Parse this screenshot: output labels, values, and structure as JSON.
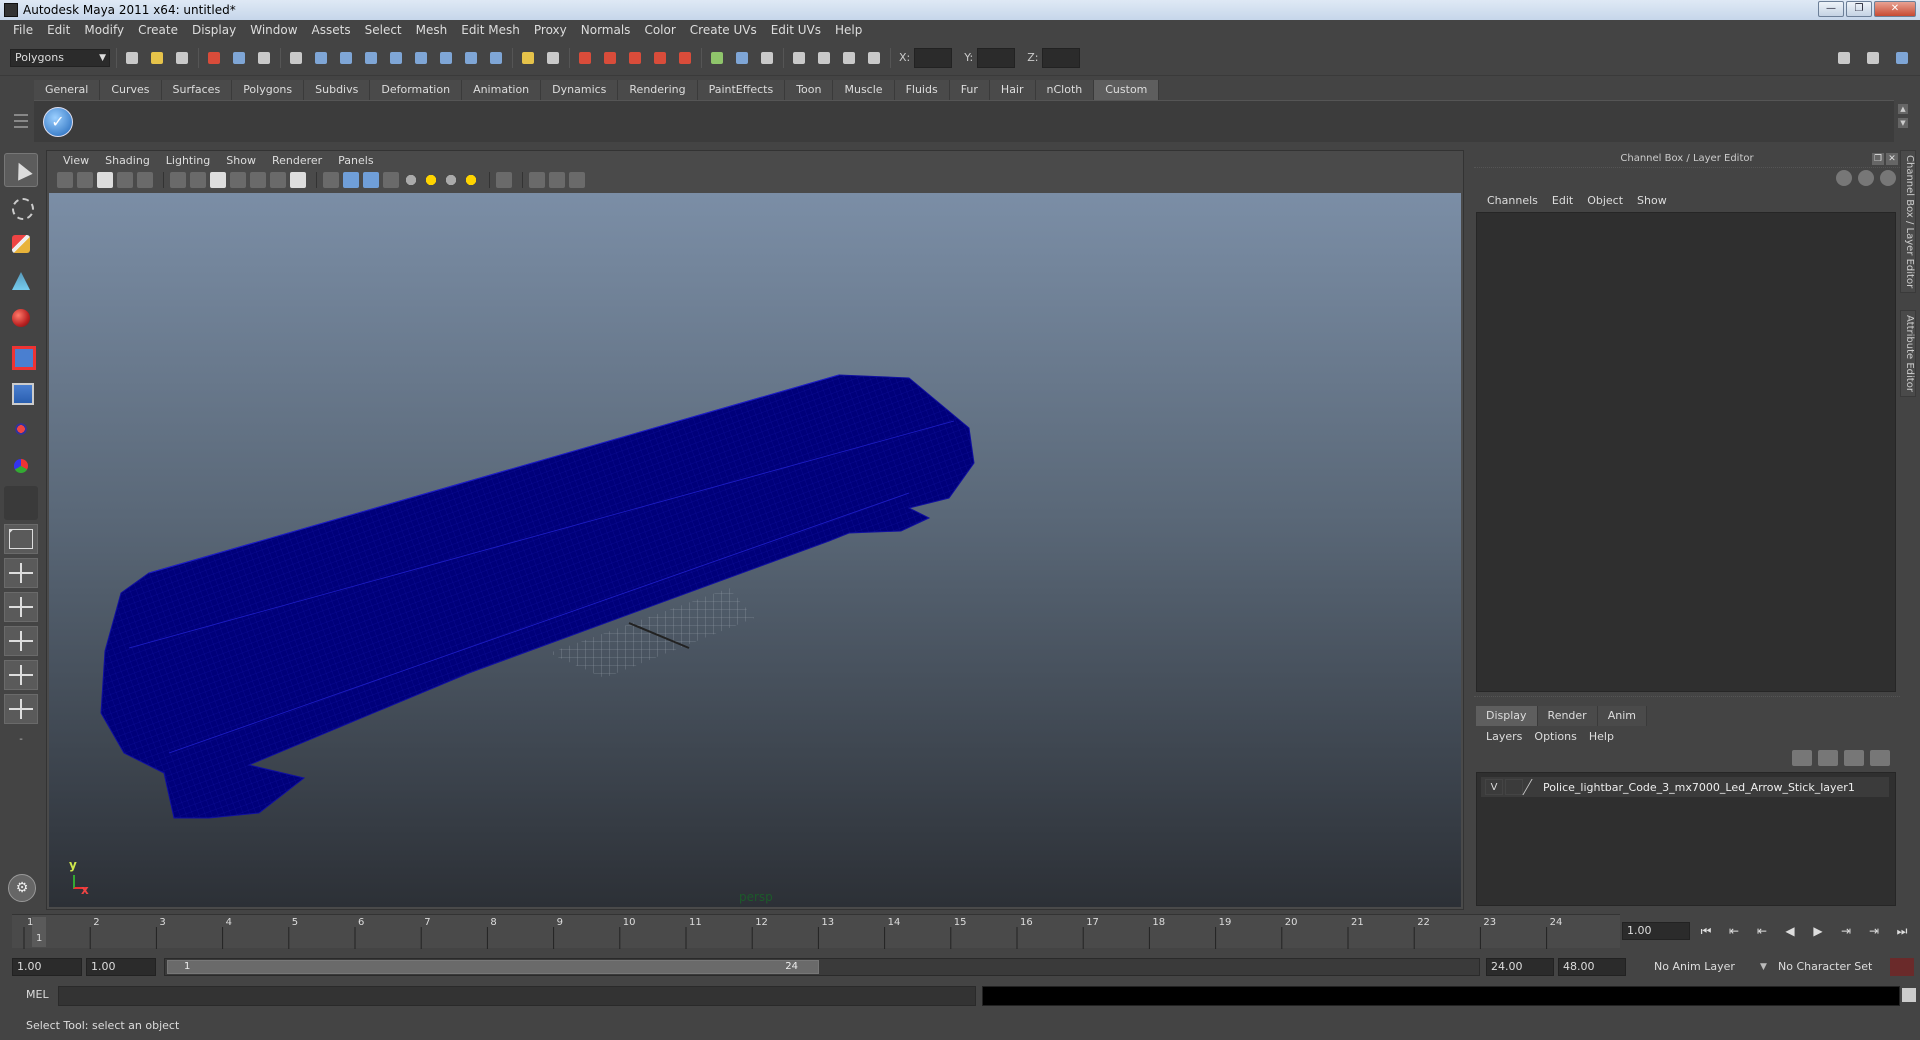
{
  "window": {
    "title": "Autodesk Maya 2011 x64: untitled*"
  },
  "menu": [
    "File",
    "Edit",
    "Modify",
    "Create",
    "Display",
    "Window",
    "Assets",
    "Select",
    "Mesh",
    "Edit Mesh",
    "Proxy",
    "Normals",
    "Color",
    "Create UVs",
    "Edit UVs",
    "Help"
  ],
  "statusline": {
    "mode": "Polygons",
    "x_label": "X:",
    "y_label": "Y:",
    "z_label": "Z:"
  },
  "shelf": {
    "tabs": [
      "General",
      "Curves",
      "Surfaces",
      "Polygons",
      "Subdivs",
      "Deformation",
      "Animation",
      "Dynamics",
      "Rendering",
      "PaintEffects",
      "Toon",
      "Muscle",
      "Fluids",
      "Fur",
      "Hair",
      "nCloth",
      "Custom"
    ],
    "active_tab": "Custom"
  },
  "icons": {
    "shelf_check": "checkmark-icon",
    "select_tool": "select-arrow-icon",
    "lasso_tool": "lasso-icon",
    "paint_tool": "paint-brush-icon",
    "move_tool": "move-icon",
    "rotate_tool": "rotate-icon",
    "scale_tool": "scale-icon"
  },
  "viewport": {
    "menu": [
      "View",
      "Shading",
      "Lighting",
      "Show",
      "Renderer",
      "Panels"
    ],
    "camera": "persp",
    "axis_y": "y",
    "axis_x": "x",
    "mesh_color": "#00007a"
  },
  "channel_box": {
    "title": "Channel Box / Layer Editor",
    "menu": [
      "Channels",
      "Edit",
      "Object",
      "Show"
    ],
    "vtabs": [
      "Channel Box / Layer Editor",
      "Attribute Editor"
    ]
  },
  "layer_editor": {
    "tabs": [
      "Display",
      "Render",
      "Anim"
    ],
    "active_tab": "Display",
    "menu": [
      "Layers",
      "Options",
      "Help"
    ],
    "layer": {
      "visible": "V",
      "name": "Police_lightbar_Code_3_mx7000_Led_Arrow_Stick_layer1"
    }
  },
  "timeslider": {
    "ticks": [
      "1",
      "2",
      "3",
      "4",
      "5",
      "6",
      "7",
      "8",
      "9",
      "10",
      "11",
      "12",
      "13",
      "14",
      "15",
      "16",
      "17",
      "18",
      "19",
      "20",
      "21",
      "22",
      "23",
      "24"
    ],
    "current": "1",
    "current_time": "1.00"
  },
  "range": {
    "start_time": "1.00",
    "playback_start": "1.00",
    "handle_start": "1",
    "handle_end": "24",
    "playback_end": "24.00",
    "end_time": "48.00",
    "anim_layer": "No Anim Layer",
    "character_set": "No Character Set"
  },
  "command": {
    "label": "MEL"
  },
  "help": {
    "text": "Select Tool: select an object"
  }
}
